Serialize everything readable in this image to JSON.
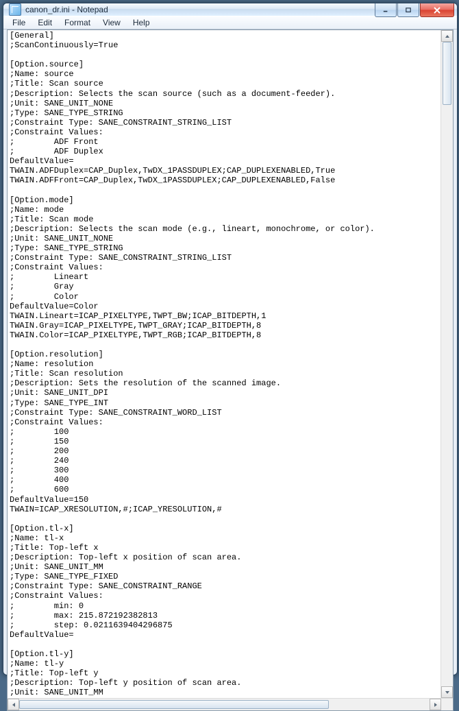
{
  "titlebar": {
    "title": "canon_dr.ini - Notepad"
  },
  "menu": {
    "file": "File",
    "edit": "Edit",
    "format": "Format",
    "view": "View",
    "help": "Help"
  },
  "editor": {
    "text": "[General]\n;ScanContinuously=True\n\n[Option.source]\n;Name: source\n;Title: Scan source\n;Description: Selects the scan source (such as a document-feeder).\n;Unit: SANE_UNIT_NONE\n;Type: SANE_TYPE_STRING\n;Constraint Type: SANE_CONSTRAINT_STRING_LIST\n;Constraint Values:\n;        ADF Front\n;        ADF Duplex\nDefaultValue=\nTWAIN.ADFDuplex=CAP_Duplex,TwDX_1PASSDUPLEX;CAP_DUPLEXENABLED,True\nTWAIN.ADFFront=CAP_Duplex,TwDX_1PASSDUPLEX;CAP_DUPLEXENABLED,False\n\n[Option.mode]\n;Name: mode\n;Title: Scan mode\n;Description: Selects the scan mode (e.g., lineart, monochrome, or color).\n;Unit: SANE_UNIT_NONE\n;Type: SANE_TYPE_STRING\n;Constraint Type: SANE_CONSTRAINT_STRING_LIST\n;Constraint Values:\n;        Lineart\n;        Gray\n;        Color\nDefaultValue=Color\nTWAIN.Lineart=ICAP_PIXELTYPE,TWPT_BW;ICAP_BITDEPTH,1\nTWAIN.Gray=ICAP_PIXELTYPE,TWPT_GRAY;ICAP_BITDEPTH,8\nTWAIN.Color=ICAP_PIXELTYPE,TWPT_RGB;ICAP_BITDEPTH,8\n\n[Option.resolution]\n;Name: resolution\n;Title: Scan resolution\n;Description: Sets the resolution of the scanned image.\n;Unit: SANE_UNIT_DPI\n;Type: SANE_TYPE_INT\n;Constraint Type: SANE_CONSTRAINT_WORD_LIST\n;Constraint Values:\n;        100\n;        150\n;        200\n;        240\n;        300\n;        400\n;        600\nDefaultValue=150\nTWAIN=ICAP_XRESOLUTION,#;ICAP_YRESOLUTION,#\n\n[Option.tl-x]\n;Name: tl-x\n;Title: Top-left x\n;Description: Top-left x position of scan area.\n;Unit: SANE_UNIT_MM\n;Type: SANE_TYPE_FIXED\n;Constraint Type: SANE_CONSTRAINT_RANGE\n;Constraint Values:\n;        min: 0\n;        max: 215.872192382813\n;        step: 0.0211639404296875\nDefaultValue=\n\n[Option.tl-y]\n;Name: tl-y\n;Title: Top-left y\n;Description: Top-left y position of scan area.\n;Unit: SANE_UNIT_MM"
  }
}
